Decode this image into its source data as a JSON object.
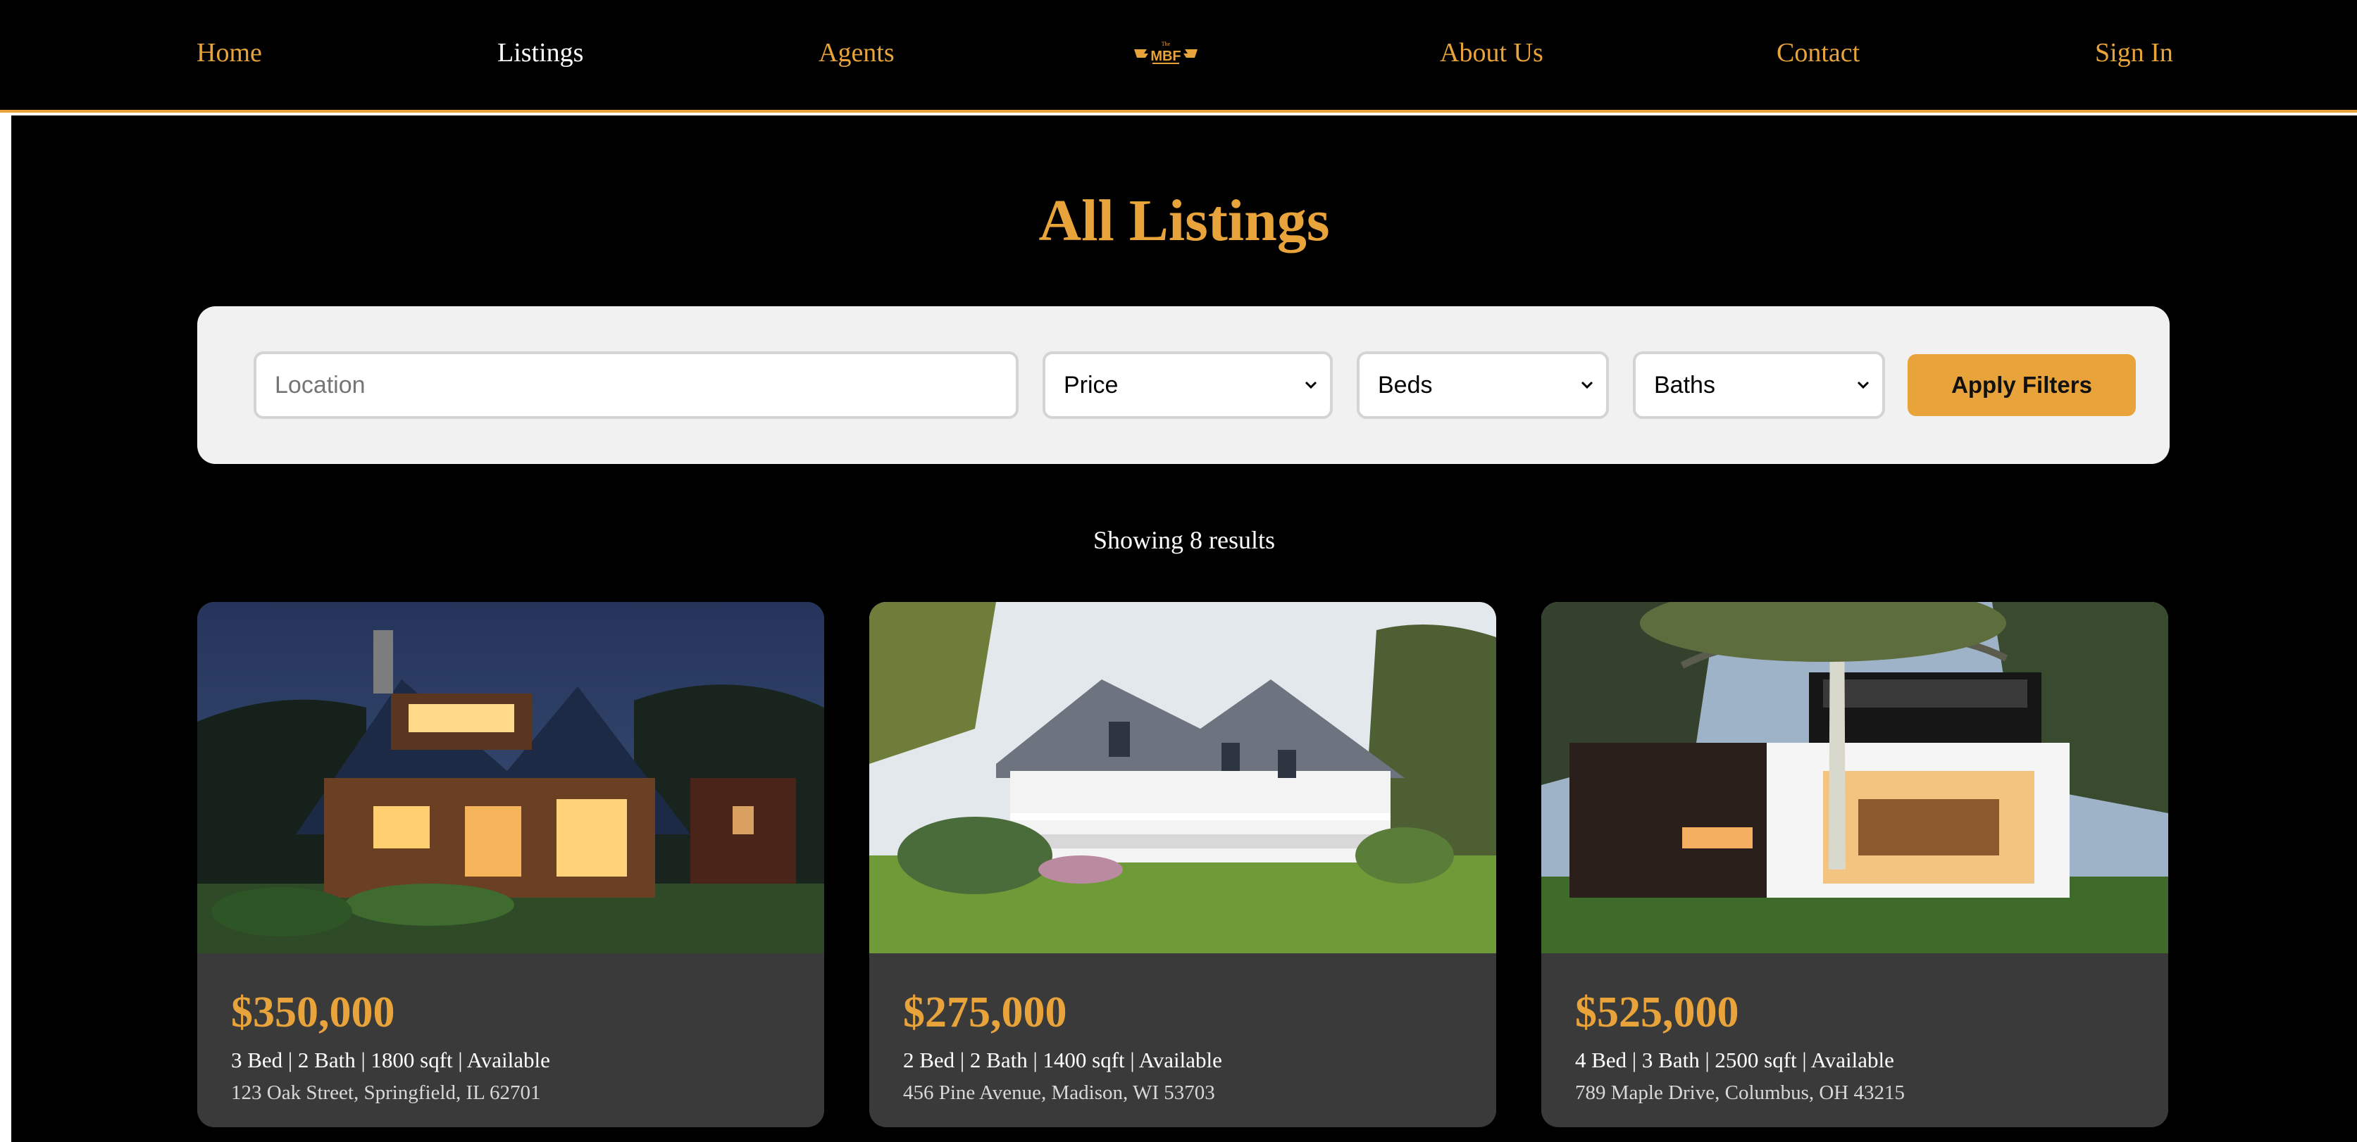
{
  "nav": {
    "home": "Home",
    "listings": "Listings",
    "agents": "Agents",
    "logo_small": "The",
    "logo_main": "MBF",
    "about": "About Us",
    "contact": "Contact",
    "sign_in": "Sign In"
  },
  "page_title": "All Listings",
  "filters": {
    "location_placeholder": "Location",
    "price": "Price",
    "beds": "Beds",
    "baths": "Baths",
    "apply_label": "Apply Filters"
  },
  "results_count": "Showing 8 results",
  "listings": [
    {
      "price": "$350,000",
      "details": "3 Bed | 2 Bath | 1800 sqft | Available",
      "address": "123 Oak Street, Springfield, IL 62701"
    },
    {
      "price": "$275,000",
      "details": "2 Bed | 2 Bath | 1400 sqft | Available",
      "address": "456 Pine Avenue, Madison, WI 53703"
    },
    {
      "price": "$525,000",
      "details": "4 Bed | 3 Bath | 2500 sqft | Available",
      "address": "789 Maple Drive, Columbus, OH 43215"
    }
  ],
  "colors": {
    "accent": "#e8a33a",
    "background": "#000000",
    "card": "#3a3a3a",
    "filter_panel": "#f1f1f1"
  }
}
